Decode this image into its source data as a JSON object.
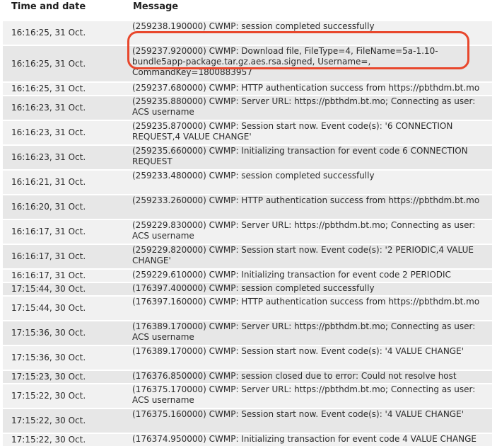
{
  "table": {
    "header": {
      "time": "Time and date",
      "message": "Message"
    },
    "rows": [
      {
        "time": "16:16:25, 31 Oct.",
        "message": "(259238.190000) CWMP: session completed successfully"
      },
      {
        "time": "16:16:25, 31 Oct.",
        "message": "(259237.920000) CWMP: Download file, FileType=4, FileName=5a-1.10-bundle5app-package.tar.gz.aes.rsa.signed, Username=, CommandKey=1800883957"
      },
      {
        "time": "16:16:25, 31 Oct.",
        "message": "(259237.680000) CWMP: HTTP authentication success from https://pbthdm.bt.mo"
      },
      {
        "time": "16:16:23, 31 Oct.",
        "message": "(259235.880000) CWMP: Server URL: https://pbthdm.bt.mo; Connecting as user: ACS username"
      },
      {
        "time": "16:16:23, 31 Oct.",
        "message": "(259235.870000) CWMP: Session start now. Event code(s): '6 CONNECTION REQUEST,4 VALUE CHANGE'"
      },
      {
        "time": "16:16:23, 31 Oct.",
        "message": "(259235.660000) CWMP: Initializing transaction for event code 6 CONNECTION REQUEST"
      },
      {
        "time": "16:16:21, 31 Oct.",
        "message": "(259233.480000) CWMP: session completed successfully"
      },
      {
        "time": "16:16:20, 31 Oct.",
        "message": "(259233.260000) CWMP: HTTP authentication success from https://pbthdm.bt.mo"
      },
      {
        "time": "16:16:17, 31 Oct.",
        "message": "(259229.830000) CWMP: Server URL: https://pbthdm.bt.mo; Connecting as user: ACS username"
      },
      {
        "time": "16:16:17, 31 Oct.",
        "message": "(259229.820000) CWMP: Session start now. Event code(s): '2 PERIODIC,4 VALUE CHANGE'"
      },
      {
        "time": "16:16:17, 31 Oct.",
        "message": "(259229.610000) CWMP: Initializing transaction for event code 2 PERIODIC"
      },
      {
        "time": "17:15:44, 30 Oct.",
        "message": "(176397.400000) CWMP: session completed successfully"
      },
      {
        "time": "17:15:44, 30 Oct.",
        "message": "(176397.160000) CWMP: HTTP authentication success from https://pbthdm.bt.mo"
      },
      {
        "time": "17:15:36, 30 Oct.",
        "message": "(176389.170000) CWMP: Server URL: https://pbthdm.bt.mo; Connecting as user: ACS username"
      },
      {
        "time": "17:15:36, 30 Oct.",
        "message": "(176389.170000) CWMP: Session start now. Event code(s): '4 VALUE CHANGE'"
      },
      {
        "time": "17:15:23, 30 Oct.",
        "message": "(176376.850000) CWMP: session closed due to error: Could not resolve host"
      },
      {
        "time": "17:15:22, 30 Oct.",
        "message": "(176375.170000) CWMP: Server URL: https://pbthdm.bt.mo; Connecting as user: ACS username"
      },
      {
        "time": "17:15:22, 30 Oct.",
        "message": "(176375.160000) CWMP: Session start now. Event code(s): '4 VALUE CHANGE'"
      },
      {
        "time": "17:15:22, 30 Oct.",
        "message": "(176374.950000) CWMP: Initializing transaction for event code 4 VALUE CHANGE"
      }
    ]
  },
  "annotation": {
    "color": "#e8472c"
  }
}
